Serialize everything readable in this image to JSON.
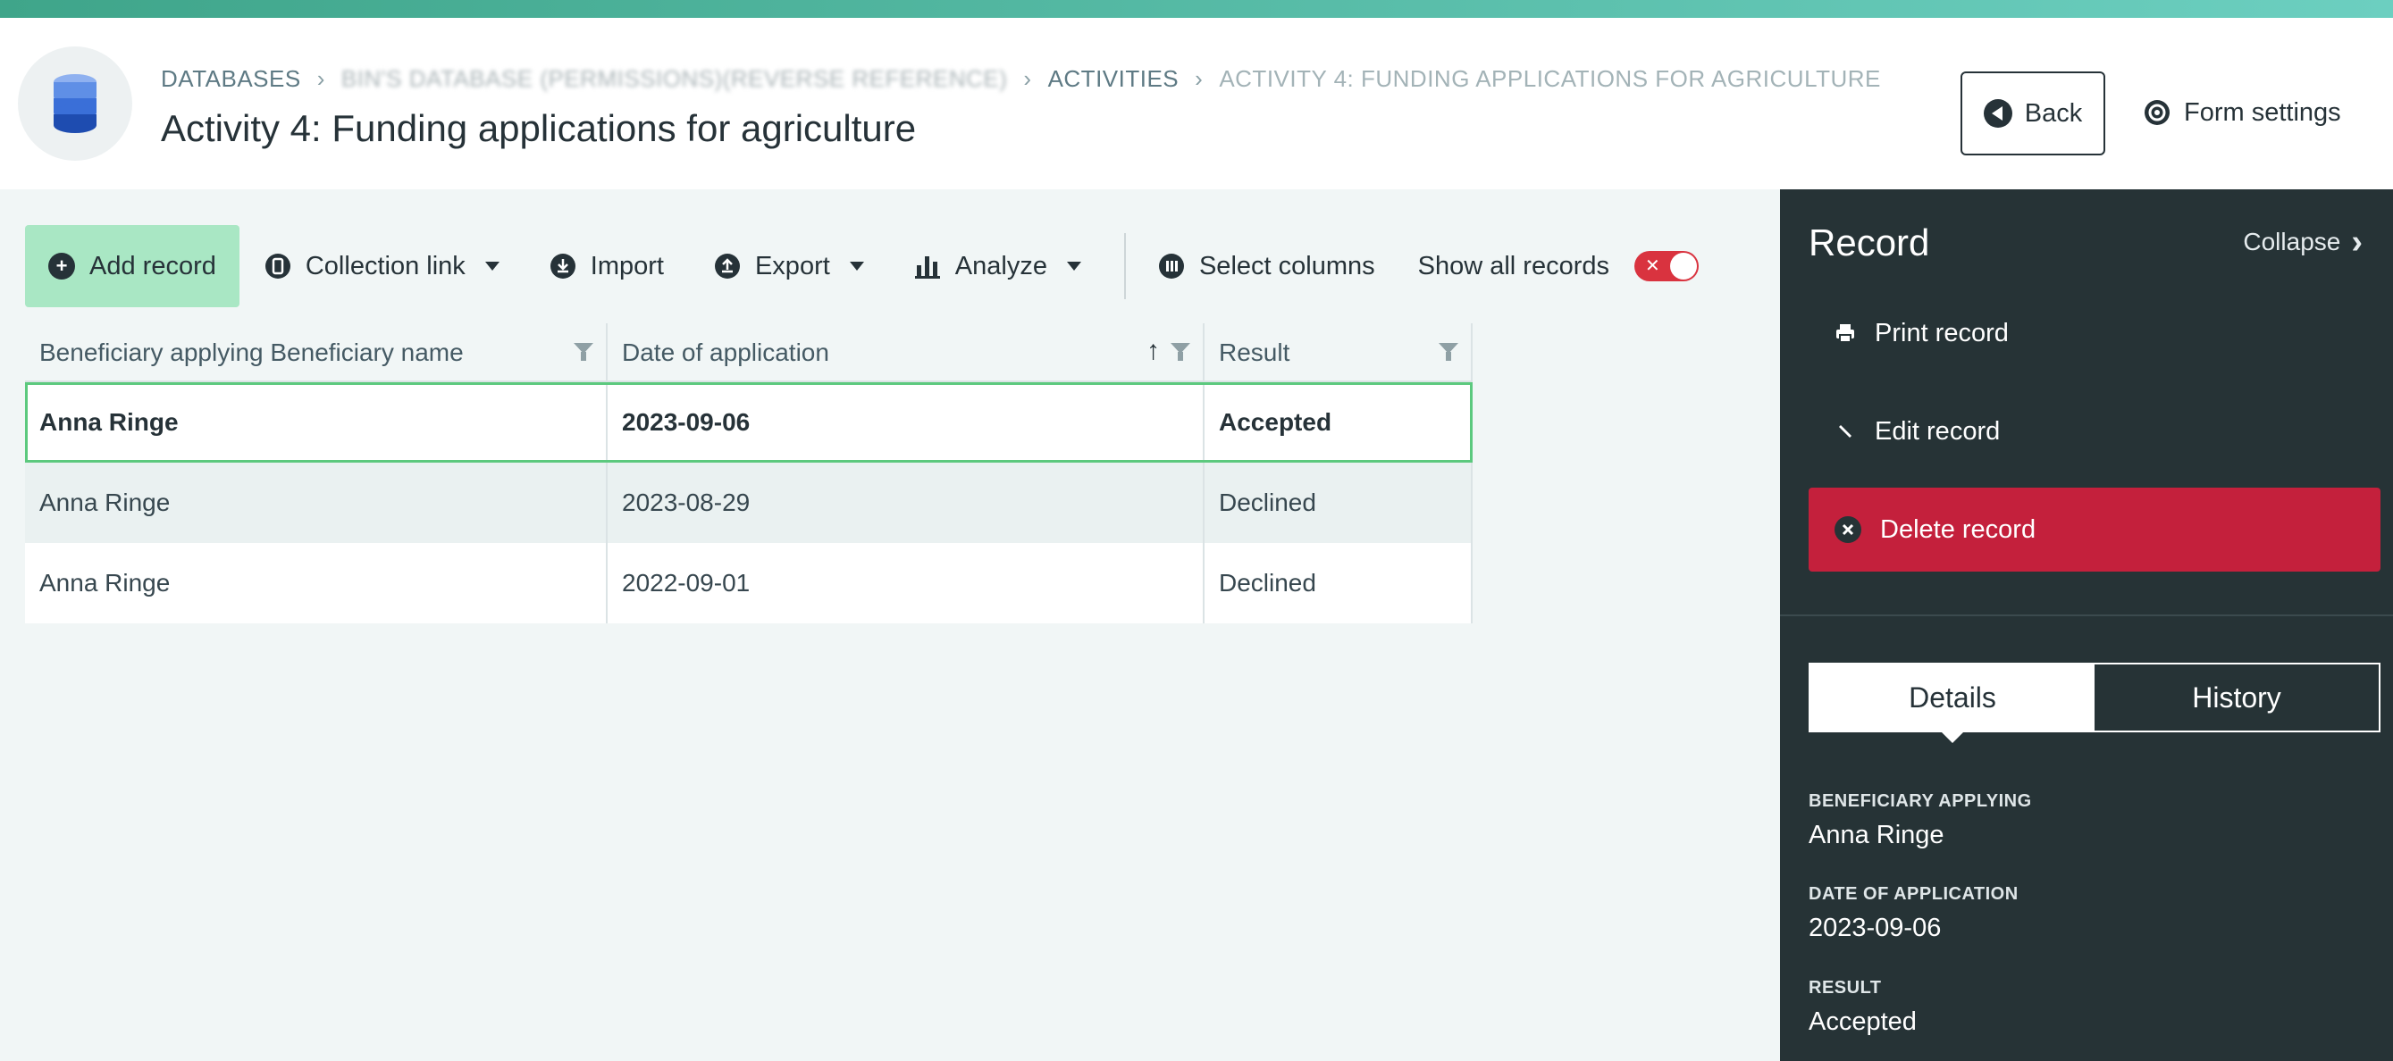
{
  "header": {
    "breadcrumb": {
      "databases": "DATABASES",
      "database_name": "BIN'S DATABASE (PERMISSIONS)(REVERSE REFERENCE)",
      "activities": "ACTIVITIES",
      "current": "ACTIVITY 4: FUNDING APPLICATIONS FOR AGRICULTURE"
    },
    "title": "Activity 4: Funding applications for agriculture",
    "back_label": "Back",
    "form_settings_label": "Form settings"
  },
  "toolbar": {
    "add_record": "Add record",
    "collection_link": "Collection link",
    "import": "Import",
    "export": "Export",
    "analyze": "Analyze",
    "select_columns": "Select columns",
    "show_all_records": "Show all records",
    "show_all_records_enabled": false
  },
  "table": {
    "columns": [
      "Beneficiary applying Beneficiary name",
      "Date of application",
      "Result"
    ],
    "sorted_column": "Date of application",
    "sort_direction": "ascending",
    "rows": [
      [
        "Anna Ringe",
        "2023-09-06",
        "Accepted"
      ],
      [
        "Anna Ringe",
        "2023-08-29",
        "Declined"
      ],
      [
        "Anna Ringe",
        "2022-09-01",
        "Declined"
      ]
    ],
    "selected_row": 0
  },
  "panel": {
    "title": "Record",
    "collapse": "Collapse",
    "actions": {
      "print": "Print record",
      "edit": "Edit record",
      "delete": "Delete record"
    },
    "tabs": [
      "Details",
      "History"
    ],
    "active_tab": "Details",
    "fields": [
      {
        "label": "BENEFICIARY APPLYING",
        "value": "Anna Ringe"
      },
      {
        "label": "DATE OF APPLICATION",
        "value": "2023-09-06"
      },
      {
        "label": "RESULT",
        "value": "Accepted"
      }
    ]
  },
  "colors": {
    "accent_green": "#a9e7c4",
    "selection_outline": "#5cc97e",
    "panel_bg": "#263336",
    "danger": "#c4203c",
    "toggle_off": "#d9333f"
  }
}
